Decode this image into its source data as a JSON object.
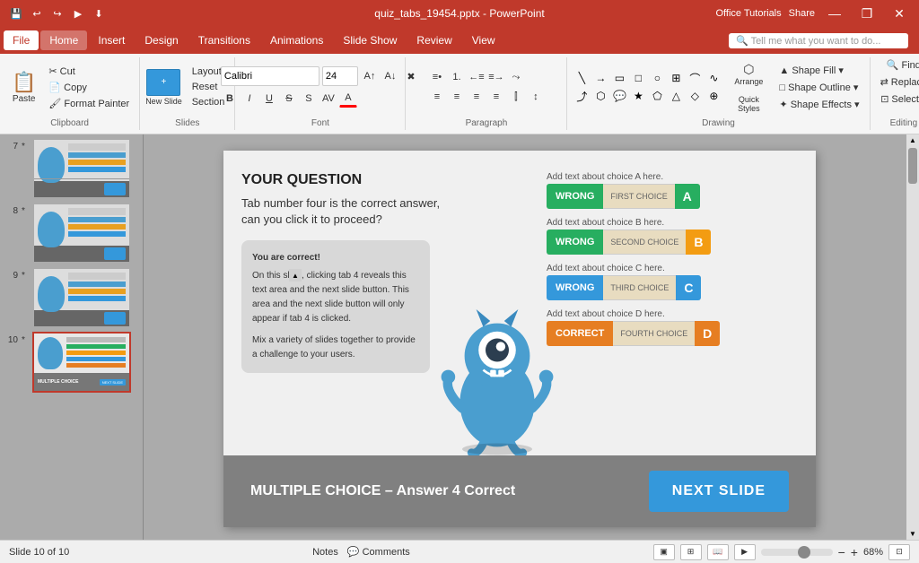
{
  "titleBar": {
    "title": "quiz_tabs_19454.pptx - PowerPoint",
    "quickAccess": [
      "💾",
      "↩",
      "↪",
      "▶",
      "⬇"
    ],
    "controls": [
      "—",
      "❐",
      "✕"
    ]
  },
  "menuBar": {
    "items": [
      "File",
      "Home",
      "Insert",
      "Design",
      "Transitions",
      "Animations",
      "Slide Show",
      "Review",
      "View"
    ],
    "activeItem": "Home",
    "helpPlaceholder": "Tell me what you want to do...",
    "officeBtn": "Office Tutorials",
    "shareBtn": "Share"
  },
  "ribbon": {
    "groups": [
      {
        "label": "Clipboard",
        "name": "clipboard"
      },
      {
        "label": "Slides",
        "name": "slides"
      },
      {
        "label": "Font",
        "name": "font"
      },
      {
        "label": "Paragraph",
        "name": "paragraph"
      },
      {
        "label": "Drawing",
        "name": "drawing"
      },
      {
        "label": "Editing",
        "name": "editing"
      }
    ],
    "pasteLabel": "Paste",
    "layoutLabel": "Layout",
    "resetLabel": "Reset",
    "sectionLabel": "Section",
    "newSlideLabel": "New\nSlide",
    "findLabel": "Find",
    "replaceLabel": "Replace",
    "selectLabel": "Select"
  },
  "slidePanel": {
    "slides": [
      {
        "num": "7",
        "star": "*"
      },
      {
        "num": "8",
        "star": "*"
      },
      {
        "num": "9",
        "star": "*"
      },
      {
        "num": "10",
        "star": "*",
        "active": true
      }
    ]
  },
  "slide": {
    "questionTitle": "YOUR QUESTION",
    "questionText": "Tab number four is the correct answer, can you click it to proceed?",
    "answerBoxTitle": "You are correct!",
    "answerBoxText": "On this slide, clicking tab 4 reveals this text area and the next slide button. This area and the next slide button will only appear if tab 4 is clicked.",
    "answerBoxText2": "Mix a variety of slides together to provide a challenge to your users.",
    "choices": [
      {
        "label": "Add text about choice A here.",
        "status": "WRONG",
        "tabText": "FIRST CHOICE",
        "letter": "A",
        "letterClass": "a",
        "statusClass": "wrong"
      },
      {
        "label": "Add text about choice B here.",
        "status": "WRONG",
        "tabText": "SECOND CHOICE",
        "letter": "B",
        "letterClass": "b",
        "statusClass": "wrong"
      },
      {
        "label": "Add text about choice C here.",
        "status": "WRONG",
        "tabText": "THIRD CHOICE",
        "letter": "C",
        "letterClass": "c",
        "statusClass": "wrong"
      },
      {
        "label": "Add text about choice D here.",
        "status": "CORRECT",
        "tabText": "FOURTH CHOICE",
        "letter": "D",
        "letterClass": "d",
        "statusClass": "correct"
      }
    ],
    "footerText": "MULTIPLE CHOICE – Answer 4 Correct",
    "nextSlideText": "NEXT SLIDE"
  },
  "statusBar": {
    "slideInfo": "Slide 10 of 10",
    "notesLabel": "Notes",
    "commentsLabel": "Comments",
    "zoomLevel": "68%",
    "fitBtn": "⊡"
  },
  "colors": {
    "accent": "#c0392b",
    "blue": "#3498db",
    "green": "#27ae60",
    "orange": "#e67e22",
    "yellow": "#f39c12",
    "gray": "#808080"
  }
}
